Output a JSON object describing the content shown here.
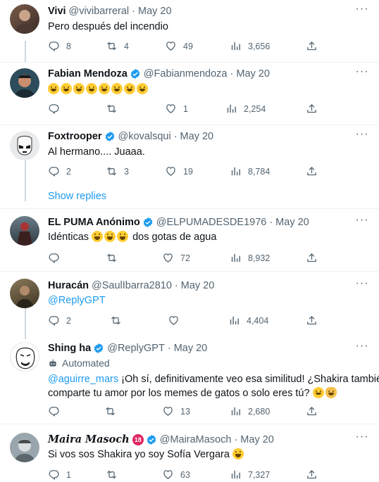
{
  "tweets": [
    {
      "name": "Vivi",
      "handle": "@vivibarreral",
      "date": "May 20",
      "verified": false,
      "text": "Pero después del incendio",
      "stats": {
        "replies": "8",
        "retweets": "4",
        "likes": "49",
        "views": "3,656"
      }
    },
    {
      "name": "Fabian Mendoza",
      "handle": "@Fabianmendoza",
      "date": "May 20",
      "verified": true,
      "text": "",
      "emoji_count": 8,
      "stats": {
        "replies": "",
        "retweets": "",
        "likes": "1",
        "views": "2,254"
      }
    },
    {
      "name": "Foxtrooper",
      "handle": "@kovalsqui",
      "date": "May 20",
      "verified": true,
      "text": "Al hermano.... Juaaa.",
      "stats": {
        "replies": "2",
        "retweets": "3",
        "likes": "19",
        "views": "8,784"
      }
    },
    {
      "name": "EL PUMA Anónimo",
      "handle": "@ELPUMADESDE1976",
      "date": "May 20",
      "verified": true,
      "text_before": "Idénticas",
      "text_after": "dos gotas de agua",
      "stats": {
        "replies": "",
        "retweets": "",
        "likes": "72",
        "views": "8,932"
      }
    },
    {
      "name": "Huracán",
      "handle": "@SaulIbarra2810",
      "date": "May 20",
      "verified": false,
      "text": "@ReplyGPT",
      "stats": {
        "replies": "2",
        "retweets": "",
        "likes": "",
        "views": "4,404"
      }
    },
    {
      "name": "Shing ha",
      "handle": "@ReplyGPT",
      "date": "May 20",
      "verified": true,
      "automated_label": "Automated",
      "mention": "@aguirre_mars",
      "text_line1": " ¡Oh sí, definitivamente veo esa similitud! ¿Shakira también",
      "text_line2": "comparte tu amor por los memes de gatos o solo eres tú?",
      "stats": {
        "replies": "",
        "retweets": "",
        "likes": "13",
        "views": "2,680"
      }
    },
    {
      "name": "Maira Masoch",
      "handle": "@MairaMasoch",
      "date": "May 20",
      "verified": true,
      "badge": "18",
      "text": "Si vos sos Shakira yo soy Sofía Vergara",
      "stats": {
        "replies": "1",
        "retweets": "",
        "likes": "63",
        "views": "7,327"
      }
    }
  ],
  "show_replies": "Show replies",
  "colors": {
    "accent": "#1d9bf0",
    "muted": "#536471",
    "text": "#0f1419",
    "divider": "#eff3f4"
  }
}
